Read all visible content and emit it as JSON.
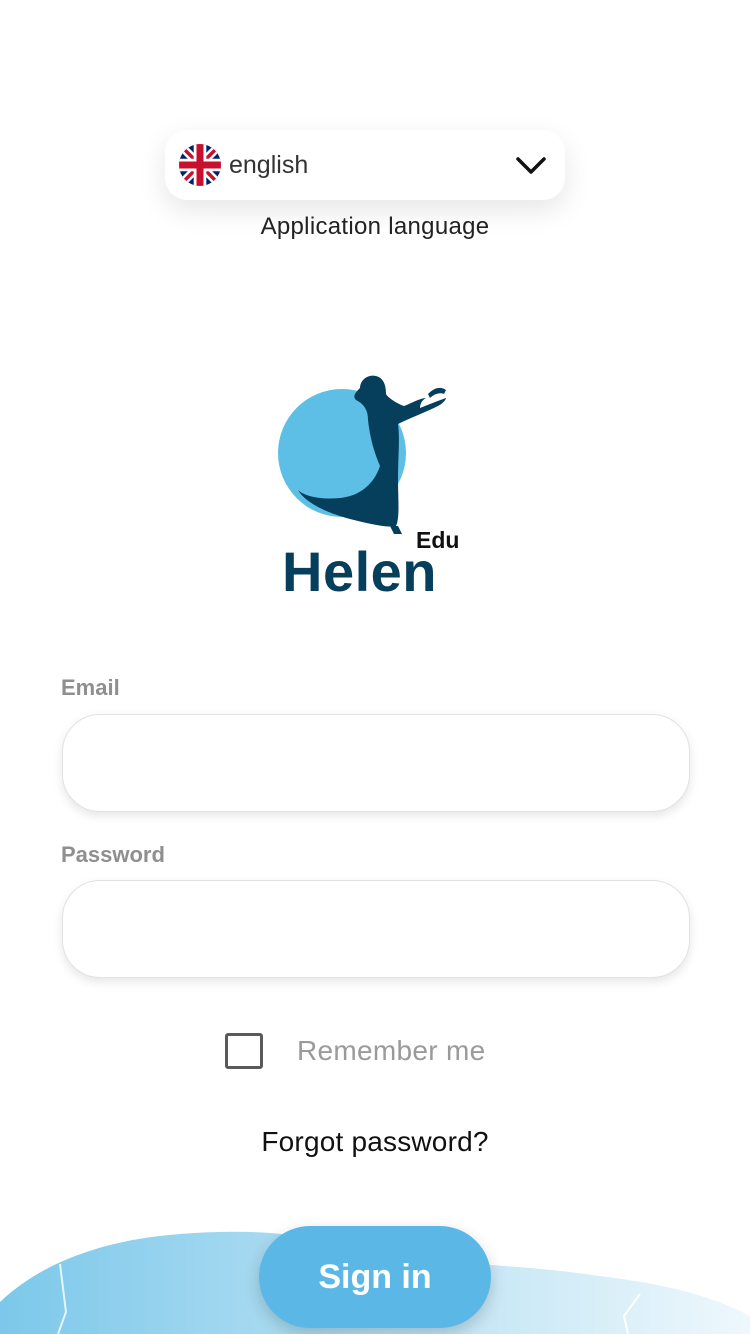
{
  "language": {
    "selected": "english",
    "caption": "Application language",
    "flag_icon": "uk-flag-icon",
    "dropdown_icon": "chevron-down-icon"
  },
  "logo": {
    "name": "Helen",
    "suffix": "Edu",
    "colors": {
      "circle": "#5ebfe6",
      "figure": "#053f5c"
    }
  },
  "form": {
    "email_label": "Email",
    "email_value": "",
    "password_label": "Password",
    "password_value": "",
    "remember_label": "Remember me",
    "remember_checked": false,
    "forgot_label": "Forgot password?",
    "signin_label": "Sign in"
  },
  "colors": {
    "accent": "#5bb8e6",
    "label": "#8f8f8f",
    "muted": "#9a9a9a"
  }
}
